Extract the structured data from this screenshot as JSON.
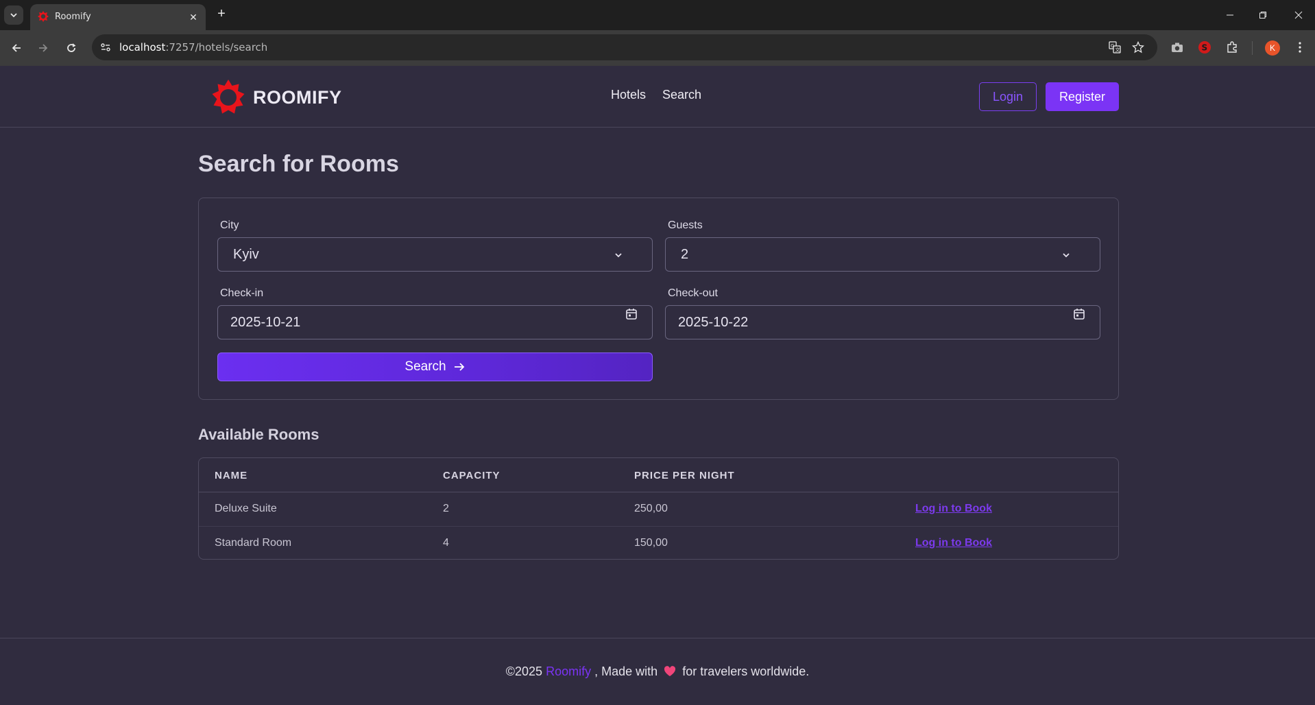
{
  "browser": {
    "tab_title": "Roomify",
    "url_host": "localhost",
    "url_rest": ":7257/hotels/search",
    "profile_initial": "K"
  },
  "header": {
    "brand": "ROOMIFY",
    "nav": [
      "Hotels",
      "Search"
    ],
    "login_label": "Login",
    "register_label": "Register"
  },
  "page": {
    "title": "Search for Rooms"
  },
  "search_form": {
    "city_label": "City",
    "city_value": "Kyiv",
    "guests_label": "Guests",
    "guests_value": "2",
    "checkin_label": "Check-in",
    "checkin_value": "2025-10-21",
    "checkout_label": "Check-out",
    "checkout_value": "2025-10-22",
    "search_label": "Search"
  },
  "results": {
    "title": "Available Rooms",
    "columns": [
      "NAME",
      "CAPACITY",
      "PRICE PER NIGHT"
    ],
    "rows": [
      {
        "name": "Deluxe Suite",
        "capacity": "2",
        "price": "250,00",
        "action": "Log in to Book"
      },
      {
        "name": "Standard Room",
        "capacity": "4",
        "price": "150,00",
        "action": "Log in to Book"
      }
    ]
  },
  "footer": {
    "prefix": "©2025",
    "brand": "Roomify",
    "middle": ", Made with",
    "suffix": "for travelers worldwide."
  },
  "colors": {
    "accent": "#7b34f5",
    "background": "#302c3f",
    "logo_red": "#e8141b"
  }
}
